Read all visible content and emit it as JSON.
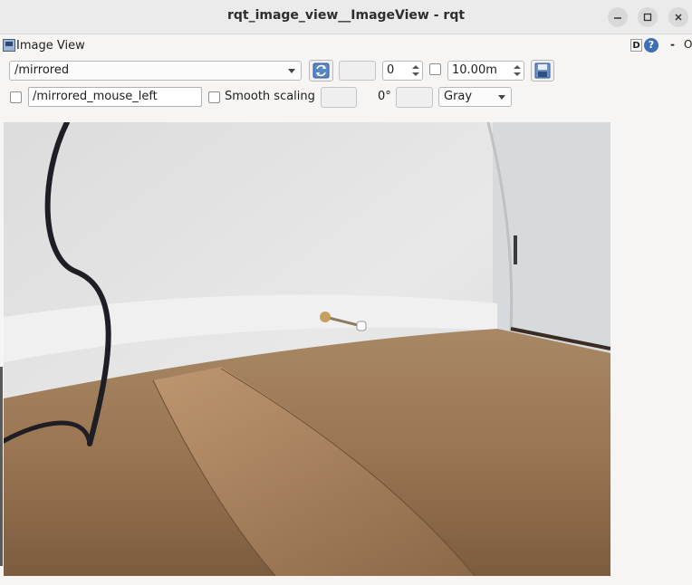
{
  "window": {
    "title": "rqt_image_view__ImageView - rqt",
    "controls": [
      "minimize-icon",
      "maximize-icon",
      "close-icon"
    ]
  },
  "plugin": {
    "title": "Image View",
    "d_button": "D",
    "help_button": "?",
    "dash": "-",
    "close_char": "O"
  },
  "toolbar": {
    "topic": "/mirrored",
    "spin_value": "0",
    "max_range": "10.00m",
    "mouse_topic": "/mirrored_mouse_left",
    "smooth_scaling_label": "Smooth scaling",
    "rotation": "0°",
    "color_scheme": "Gray"
  },
  "icons": {
    "refresh": "refresh-icon",
    "save": "save-icon",
    "plugin": "image-view-icon"
  }
}
